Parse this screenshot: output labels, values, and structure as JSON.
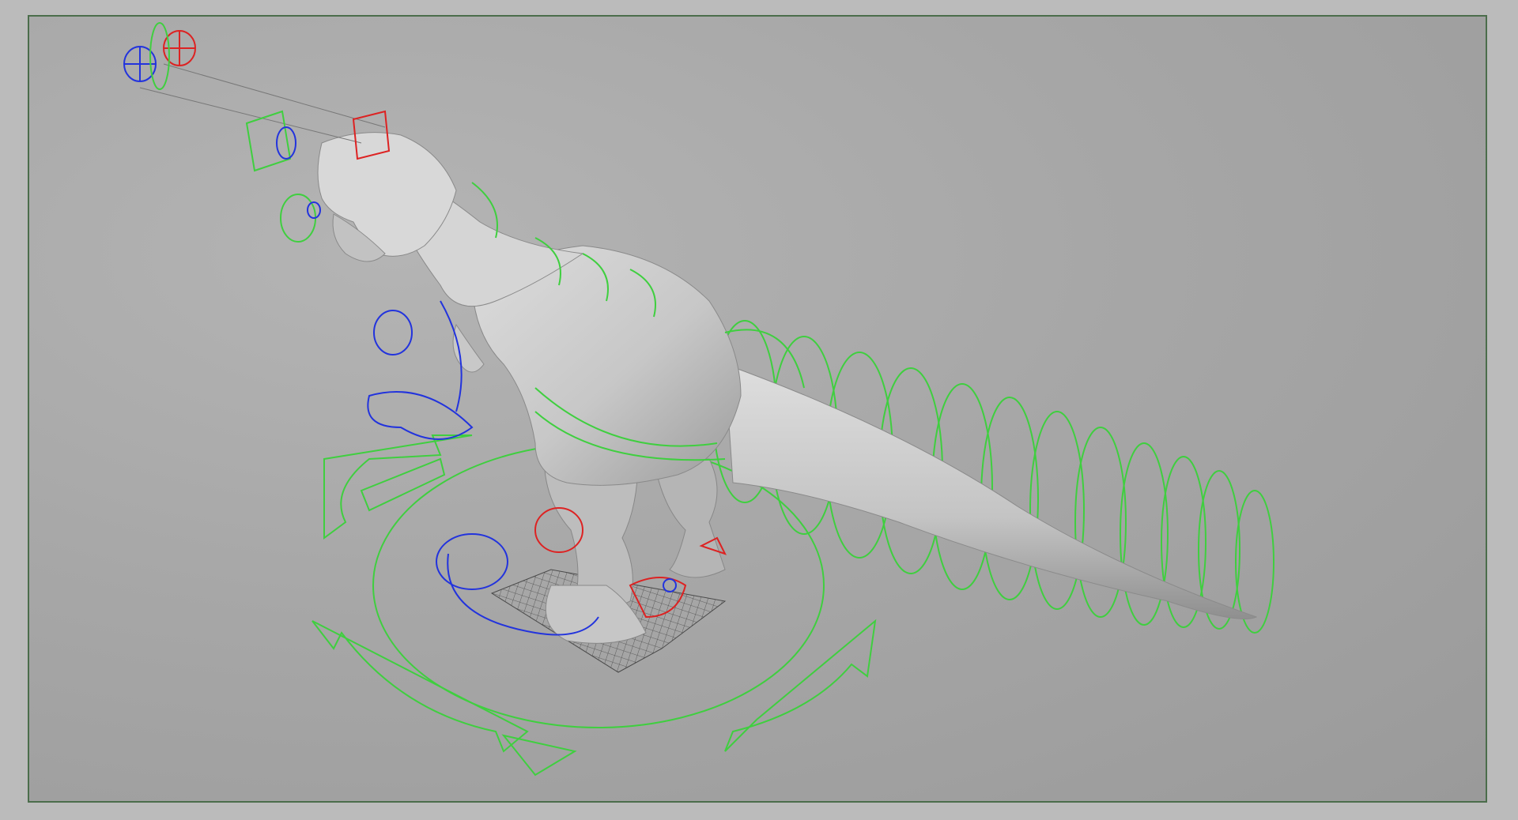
{
  "app": {
    "viewport": {
      "background": "#a5a5a5",
      "border_color": "#4b6d4b",
      "mesh_color": "#d2d2d2",
      "mesh_shadow": "#8e8e8e"
    },
    "rig_colors": {
      "center_controls": "#3fcf3f",
      "left_controls": "#2233dd",
      "right_controls": "#dd2222",
      "grid": "#4a4a4a"
    },
    "scene_objects": {
      "model": "trex-mesh",
      "controls": [
        "global-move-control",
        "tail-controls",
        "spine-controls",
        "head-controls",
        "eye-aim-controls",
        "arm-controls",
        "foot-controls",
        "foot-grid"
      ]
    }
  }
}
